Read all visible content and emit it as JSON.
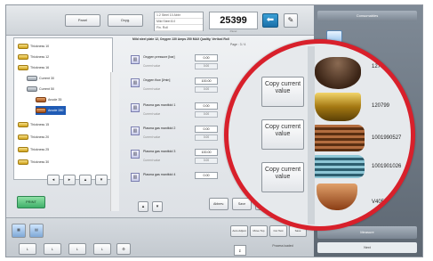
{
  "top_bar": {
    "panel_select_label": "Panel",
    "panel_select_2_label": "Oxyg.",
    "mini_grid": [
      "1.2 Steel 10 Abbr",
      "Mild Steel 8.0",
      "Fin. Roll"
    ],
    "counter": "25399",
    "counter_sub": "Panel",
    "back_glyph": "⬅",
    "pen_glyph": "✎"
  },
  "tree": {
    "items": [
      {
        "label": "Thickness 10",
        "icon": "gold"
      },
      {
        "label": "Thickness 12",
        "icon": "gold"
      },
      {
        "label": "Thickness 16",
        "icon": "gold"
      },
      {
        "label": "Current 30",
        "icon": "gray"
      },
      {
        "label": "Current 50",
        "icon": "gray"
      },
      {
        "label": "Anode 35",
        "icon": "copper"
      },
      {
        "label": "Anode 280",
        "icon": "copper",
        "selected": true
      },
      {
        "label": "Thickness 15",
        "icon": "gold"
      },
      {
        "label": "Thickness 20",
        "icon": "gold"
      },
      {
        "label": "Thickness 25",
        "icon": "gold"
      },
      {
        "label": "Thickness 30",
        "icon": "gold"
      }
    ]
  },
  "nav": [
    "◂",
    "▸",
    "▴",
    "▾"
  ],
  "green_button": "PRINT",
  "params": {
    "header": "Mild steel plate 12, Oxygen 130 Amps 250 MAX Quality, Vertical Roll",
    "page": "Page : 3 / 4",
    "rows": [
      {
        "label": "Oxygen pressure [bar]",
        "sublabel": "Current value",
        "value": "0.00",
        "sub_value": "0.00"
      },
      {
        "label": "Oxygen flow [l/min]",
        "sublabel": "Current value",
        "value": "100.00",
        "sub_value": "0.00"
      },
      {
        "label": "Plasma gas manifold 1",
        "sublabel": "Current value",
        "value": "0.00",
        "sub_value": "0.00"
      },
      {
        "label": "Plasma gas manifold 2",
        "sublabel": "Current value",
        "value": "0.00",
        "sub_value": "0.00"
      },
      {
        "label": "Plasma gas manifold 3",
        "sublabel": "Current value",
        "value": "100.00",
        "sub_value": "0.00"
      },
      {
        "label": "Plasma gas manifold 4",
        "sublabel": "Current value",
        "value": "0.00",
        "sub_value": "0.00"
      }
    ],
    "copy_label": "Copy current value"
  },
  "actions": {
    "btn1": "Abbrev.",
    "btn2": "Save",
    "btn3": "Restore",
    "btn4": "Apply"
  },
  "right_panel": {
    "header": "Consumables",
    "icon1_label": "Part Configuration",
    "icon2_label": "Consumables",
    "footer": "Measure",
    "footer2": "Next"
  },
  "parts": {
    "labels": [
      "120PHB",
      "1275",
      "120PHB",
      "220827",
      "1001",
      "220826",
      "120PHB"
    ]
  },
  "magnifier": {
    "labels": [
      "1275",
      "120799",
      "1001990527",
      "1001901026",
      "V4050"
    ],
    "copy_label": "Copy current value"
  },
  "bottom": {
    "buttons": [
      "L",
      "L",
      "L",
      "L"
    ],
    "right_buttons": [
      "Auto Adjust",
      "Move Top",
      "Cut Test",
      "Save"
    ],
    "status": "Process loaded"
  },
  "colors": {
    "highlight_ring": "#d8202b",
    "tree_selected": "#1f5bb5",
    "green_button": "#3fb06a",
    "back_button": "#1b6fa8"
  }
}
